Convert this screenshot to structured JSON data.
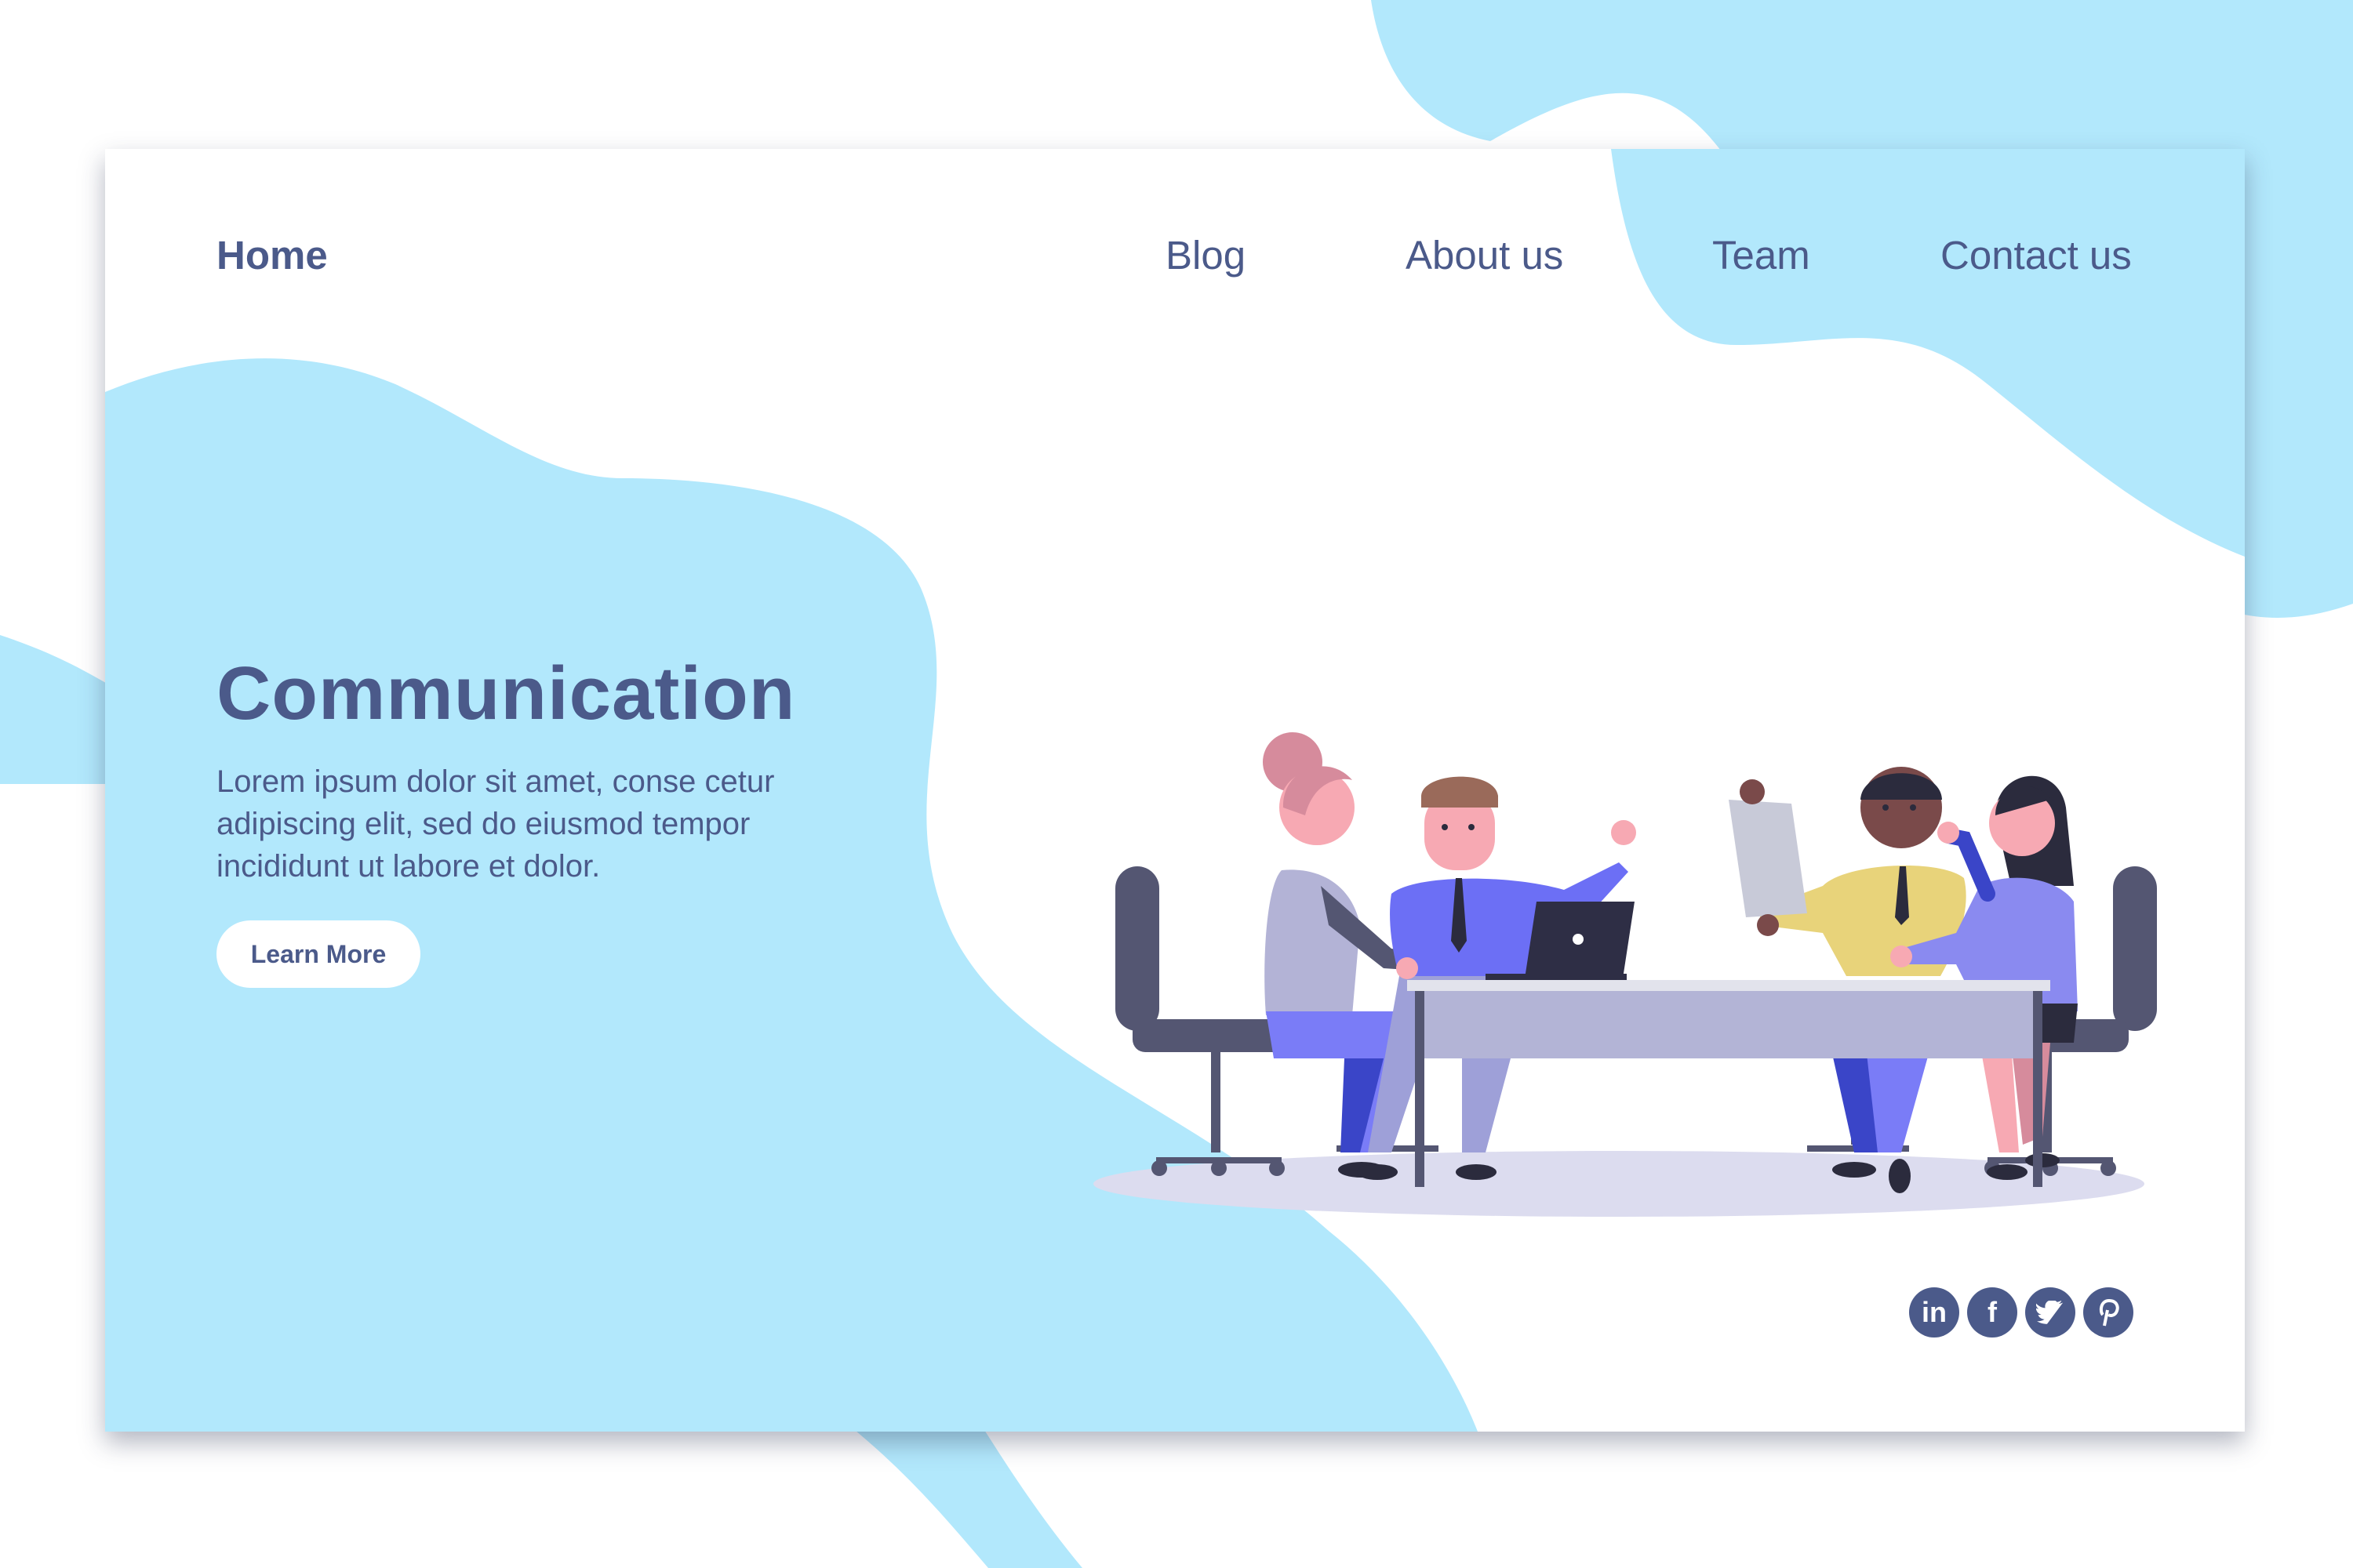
{
  "nav": {
    "home": "Home",
    "links": [
      "Blog",
      "About us",
      "Team",
      "Contact us"
    ]
  },
  "hero": {
    "title": "Communication",
    "text": "Lorem ipsum dolor sit amet, conse cetur adipiscing elit, sed do eiusmod tempor incididunt ut labore et dolor.",
    "button": "Learn More"
  },
  "social": [
    "linkedin-icon",
    "facebook-icon",
    "twitter-icon",
    "pinterest-icon"
  ],
  "social_glyphs": [
    "in",
    "f",
    "",
    ""
  ],
  "colors": {
    "accent": "#4b5a8a",
    "blob": "#b2e8fc",
    "background": "#ffffff"
  }
}
